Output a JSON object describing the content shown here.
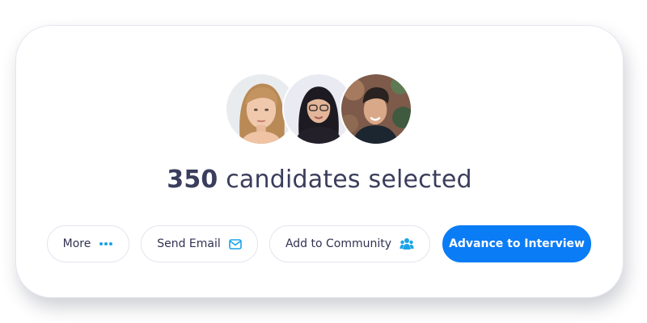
{
  "selection": {
    "count": "350",
    "label": " candidates selected"
  },
  "avatars": [
    {
      "name": "candidate-avatar-1"
    },
    {
      "name": "candidate-avatar-2"
    },
    {
      "name": "candidate-avatar-3"
    }
  ],
  "actions": {
    "more_label": "More",
    "more_icon": "more-dots-icon",
    "send_email_label": "Send Email",
    "send_email_icon": "envelope-icon",
    "add_community_label": "Add to Community",
    "add_community_icon": "people-group-icon",
    "advance_label": "Advance to Interview"
  },
  "colors": {
    "accent": "#0a7cf6",
    "icon": "#1aa3e8",
    "text": "#3a3d5c"
  }
}
